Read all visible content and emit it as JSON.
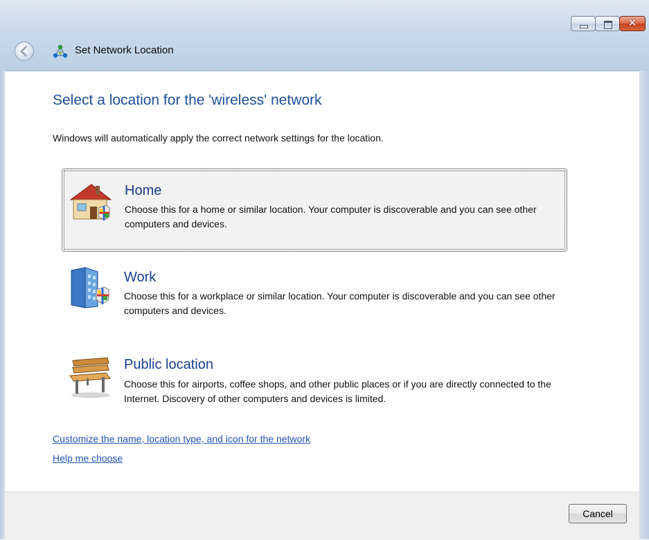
{
  "window": {
    "title": "Set Network Location",
    "controls": {
      "minimize": "minimize-icon",
      "maximize": "maximize-icon",
      "close": "close-icon"
    }
  },
  "main": {
    "heading": "Select a location for the 'wireless' network",
    "intro": "Windows will automatically apply the correct network settings for the location.",
    "options": [
      {
        "title": "Home",
        "description": "Choose this for a home or similar location. Your computer is discoverable and you can see other computers and devices.",
        "icon": "home-icon",
        "selected": true
      },
      {
        "title": "Work",
        "description": "Choose this for a workplace or similar location. Your computer is discoverable and you can see other computers and devices.",
        "icon": "office-building-icon",
        "selected": false
      },
      {
        "title": "Public location",
        "description": "Choose this for airports, coffee shops, and other public places or if you are directly connected to the Internet. Discovery of other computers and devices is limited.",
        "icon": "park-bench-icon",
        "selected": false
      }
    ],
    "links": {
      "customize": "Customize the name, location type, and icon for the network",
      "help": "Help me choose"
    }
  },
  "footer": {
    "cancel_label": "Cancel"
  },
  "colors": {
    "heading": "#1e4f9a",
    "link": "#1f55b8",
    "selected_bg": "#f2f2f2",
    "footer_bg": "#f0f0f0"
  }
}
